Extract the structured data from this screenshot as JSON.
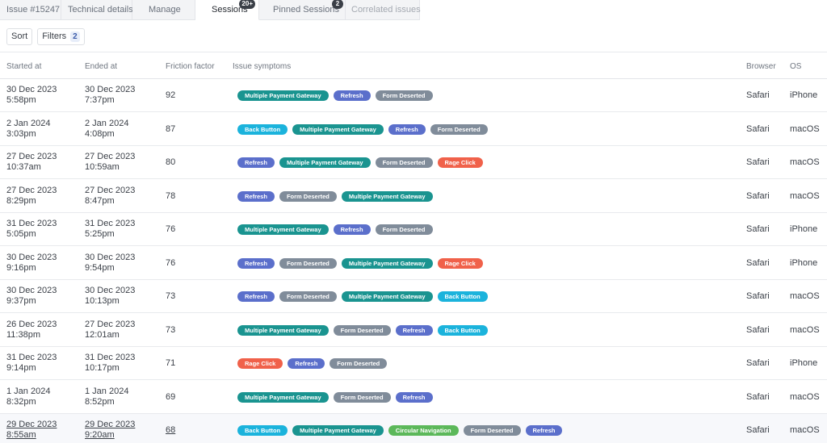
{
  "tabs": [
    {
      "label": "Issue #15247",
      "badge": null
    },
    {
      "label": "Technical details",
      "badge": null
    },
    {
      "label": "Manage",
      "badge": null
    },
    {
      "label": "Sessions",
      "badge": "20+"
    },
    {
      "label": "Pinned Sessions",
      "badge": "2"
    },
    {
      "label": "Correlated issues",
      "badge": null
    }
  ],
  "toolbar": {
    "sort_label": "Sort",
    "filters_label": "Filters",
    "filters_count": "2"
  },
  "columns": {
    "started": "Started at",
    "ended": "Ended at",
    "friction": "Friction factor",
    "symptoms": "Issue symptoms",
    "browser": "Browser",
    "os": "OS"
  },
  "colors": {
    "Multiple Payment Gateway": "#1a9490",
    "Refresh": "#5b6fcb",
    "Form Deserted": "#808c9a",
    "Back Button": "#1bb3dc",
    "Rage Click": "#f0614a",
    "Circular Navigation": "#5cb85a"
  },
  "rows": [
    {
      "start_date": "30 Dec 2023",
      "start_time": "5:58pm",
      "end_date": "30 Dec 2023",
      "end_time": "7:37pm",
      "friction": "92",
      "symptoms": [
        "Multiple Payment Gateway",
        "Refresh",
        "Form Deserted"
      ],
      "browser": "Safari",
      "os": "iPhone"
    },
    {
      "start_date": "2 Jan 2024",
      "start_time": "3:03pm",
      "end_date": "2 Jan 2024",
      "end_time": "4:08pm",
      "friction": "87",
      "symptoms": [
        "Back Button",
        "Multiple Payment Gateway",
        "Refresh",
        "Form Deserted"
      ],
      "browser": "Safari",
      "os": "macOS"
    },
    {
      "start_date": "27 Dec 2023",
      "start_time": "10:37am",
      "end_date": "27 Dec 2023",
      "end_time": "10:59am",
      "friction": "80",
      "symptoms": [
        "Refresh",
        "Multiple Payment Gateway",
        "Form Deserted",
        "Rage Click"
      ],
      "browser": "Safari",
      "os": "macOS"
    },
    {
      "start_date": "27 Dec 2023",
      "start_time": "8:29pm",
      "end_date": "27 Dec 2023",
      "end_time": "8:47pm",
      "friction": "78",
      "symptoms": [
        "Refresh",
        "Form Deserted",
        "Multiple Payment Gateway"
      ],
      "browser": "Safari",
      "os": "macOS"
    },
    {
      "start_date": "31 Dec 2023",
      "start_time": "5:05pm",
      "end_date": "31 Dec 2023",
      "end_time": "5:25pm",
      "friction": "76",
      "symptoms": [
        "Multiple Payment Gateway",
        "Refresh",
        "Form Deserted"
      ],
      "browser": "Safari",
      "os": "iPhone"
    },
    {
      "start_date": "30 Dec 2023",
      "start_time": "9:16pm",
      "end_date": "30 Dec 2023",
      "end_time": "9:54pm",
      "friction": "76",
      "symptoms": [
        "Refresh",
        "Form Deserted",
        "Multiple Payment Gateway",
        "Rage Click"
      ],
      "browser": "Safari",
      "os": "iPhone"
    },
    {
      "start_date": "30 Dec 2023",
      "start_time": "9:37pm",
      "end_date": "30 Dec 2023",
      "end_time": "10:13pm",
      "friction": "73",
      "symptoms": [
        "Refresh",
        "Form Deserted",
        "Multiple Payment Gateway",
        "Back Button"
      ],
      "browser": "Safari",
      "os": "macOS"
    },
    {
      "start_date": "26 Dec 2023",
      "start_time": "11:38pm",
      "end_date": "27 Dec 2023",
      "end_time": "12:01am",
      "friction": "73",
      "symptoms": [
        "Multiple Payment Gateway",
        "Form Deserted",
        "Refresh",
        "Back Button"
      ],
      "browser": "Safari",
      "os": "macOS"
    },
    {
      "start_date": "31 Dec 2023",
      "start_time": "9:14pm",
      "end_date": "31 Dec 2023",
      "end_time": "10:17pm",
      "friction": "71",
      "symptoms": [
        "Rage Click",
        "Refresh",
        "Form Deserted"
      ],
      "browser": "Safari",
      "os": "iPhone"
    },
    {
      "start_date": "1 Jan 2024",
      "start_time": "8:32pm",
      "end_date": "1 Jan 2024",
      "end_time": "8:52pm",
      "friction": "69",
      "symptoms": [
        "Multiple Payment Gateway",
        "Form Deserted",
        "Refresh"
      ],
      "browser": "Safari",
      "os": "macOS"
    },
    {
      "start_date": "29 Dec 2023",
      "start_time": "8:55am",
      "end_date": "29 Dec 2023",
      "end_time": "9:20am",
      "friction": "68",
      "symptoms": [
        "Back Button",
        "Multiple Payment Gateway",
        "Circular Navigation",
        "Form Deserted",
        "Refresh"
      ],
      "browser": "Safari",
      "os": "macOS"
    }
  ]
}
